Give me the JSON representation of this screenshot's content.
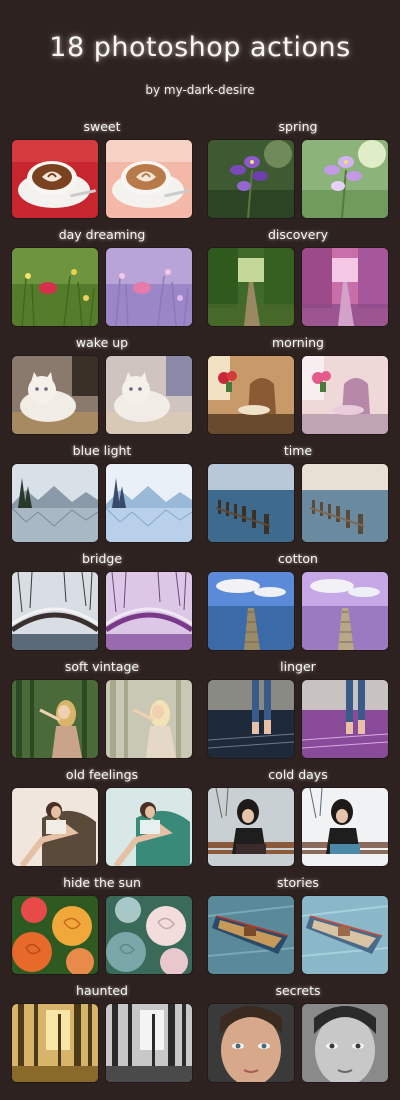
{
  "header": {
    "title": "18 photoshop actions",
    "byline": "by my-dark-desire"
  },
  "actions": [
    {
      "label": "sweet",
      "scene": "coffee-cup"
    },
    {
      "label": "spring",
      "scene": "purple-flowers"
    },
    {
      "label": "day dreaming",
      "scene": "pink-flower-field"
    },
    {
      "label": "discovery",
      "scene": "tree-lined-road"
    },
    {
      "label": "wake up",
      "scene": "white-kitten"
    },
    {
      "label": "morning",
      "scene": "armchair-room"
    },
    {
      "label": "blue light",
      "scene": "lake-mountains"
    },
    {
      "label": "time",
      "scene": "sea-pier-posts"
    },
    {
      "label": "bridge",
      "scene": "snowy-bridge"
    },
    {
      "label": "cotton",
      "scene": "jetty-sky"
    },
    {
      "label": "soft vintage",
      "scene": "girl-forest"
    },
    {
      "label": "linger",
      "scene": "legs-water"
    },
    {
      "label": "old feelings",
      "scene": "girl-armchair"
    },
    {
      "label": "cold days",
      "scene": "girl-bench"
    },
    {
      "label": "hide the sun",
      "scene": "roses"
    },
    {
      "label": "stories",
      "scene": "rowboat"
    },
    {
      "label": "haunted",
      "scene": "misty-forest"
    },
    {
      "label": "secrets",
      "scene": "face-portrait"
    }
  ]
}
